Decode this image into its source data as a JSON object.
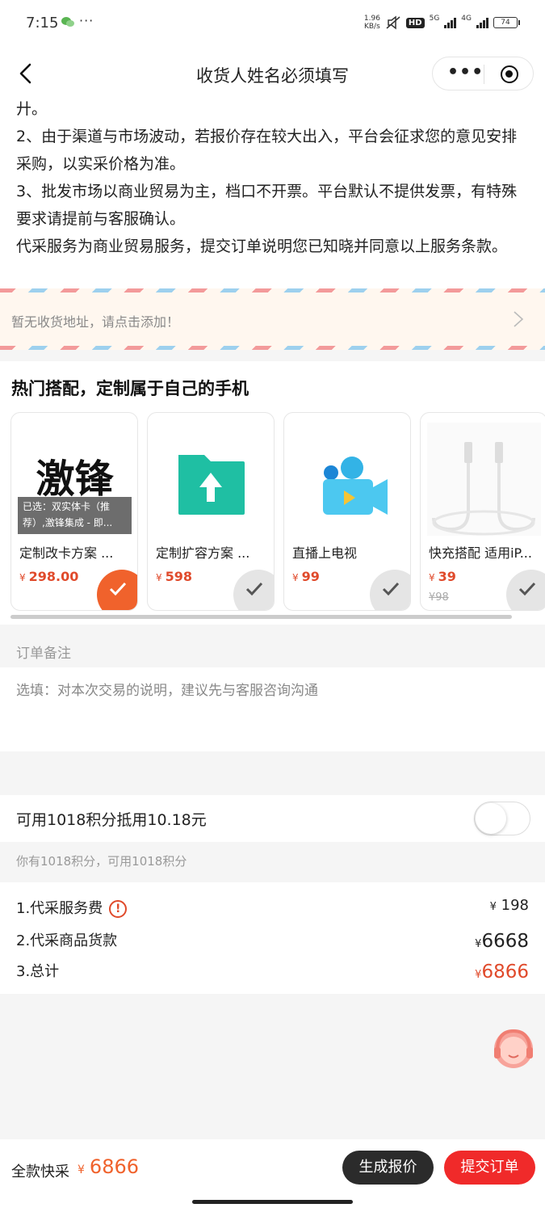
{
  "status_bar": {
    "time": "7:15",
    "dots": "···",
    "speed_value": "1.96",
    "speed_unit": "KB/s",
    "hd": "HD",
    "net1": "5G",
    "net2": "4G",
    "battery": "74"
  },
  "nav": {
    "title": "收货人姓名必须填写",
    "more": "•••"
  },
  "notice": {
    "lines": [
      "廾。",
      "2、由于渠道与市场波动，若报价存在较大出入，平台会征求您的意见安排采购，以实采价格为准。",
      "3、批发市场以商业贸易为主，档口不开票。平台默认不提供发票，有特殊要求请提前与客服确认。",
      "代采服务为商业贸易服务，提交订单说明您已知晓并同意以上服务条款。"
    ]
  },
  "address": {
    "placeholder": "暂无收货地址，请点击添加！"
  },
  "hot": {
    "title": "热门搭配，定制属于自己的手机",
    "products": [
      {
        "name": "定制改卡方案 ...",
        "currency": "¥",
        "price": "298.00",
        "selected": true,
        "thumb_text": "激锋",
        "overlay": "已选：双实体卡（推荐）,激锋集成 - 即..."
      },
      {
        "name": "定制扩容方案 ...",
        "currency": "¥",
        "price": "598",
        "selected": false
      },
      {
        "name": "直播上电视",
        "currency": "¥",
        "price": "99",
        "selected": false
      },
      {
        "name": "快充搭配 适用iP...",
        "currency": "¥",
        "price": "39",
        "old_price": "¥98",
        "selected": false
      }
    ]
  },
  "remark": {
    "label": "订单备注",
    "placeholder": "选填：对本次交易的说明，建议先与客服咨询沟通"
  },
  "points": {
    "label": "可用1018积分抵用10.18元",
    "enabled": false,
    "sub": "你有1018积分，可用1018积分"
  },
  "fees": [
    {
      "label": "1.代采服务费",
      "currency": "¥",
      "value": "198"
    },
    {
      "label": "2.代采商品货款",
      "currency": "¥",
      "value": "6668"
    },
    {
      "label": "3.总计",
      "currency": "¥",
      "value": "6866"
    }
  ],
  "bottom": {
    "label": "全款快采",
    "currency": "¥",
    "total": "6866",
    "quote_button": "生成报价",
    "submit_button": "提交订单"
  },
  "colors": {
    "accent": "#f0622c",
    "price_red": "#e04a2b",
    "submit": "#f02a2a"
  }
}
